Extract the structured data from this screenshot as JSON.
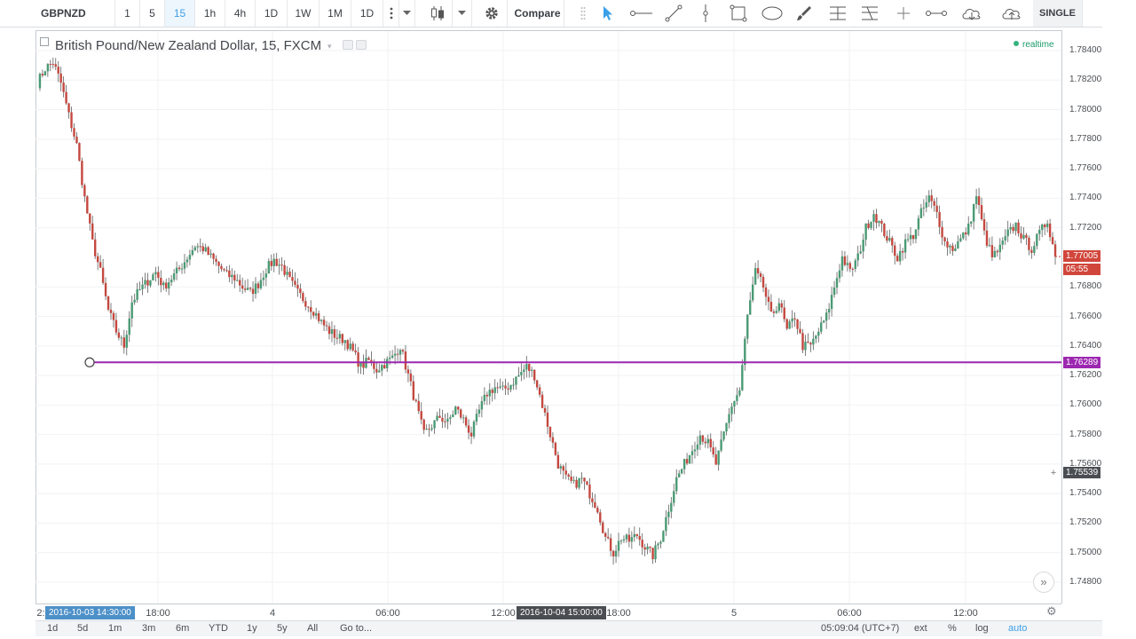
{
  "toolbar": {
    "symbol": "GBPNZD",
    "intervals": [
      "1",
      "5",
      "15",
      "1h",
      "4h",
      "1D",
      "1W",
      "1M",
      "1D"
    ],
    "active_interval": "15",
    "compare_label": "Compare",
    "layout_label": "SINGLE",
    "drawing_tools": [
      "cursor-icon",
      "horizontal-ray-icon",
      "trend-line-icon",
      "vertical-line-icon",
      "rectangle-icon",
      "ellipse-icon",
      "brush-icon",
      "fib-retracement-icon",
      "fib-extension-icon",
      "crosshair-icon",
      "measure-icon",
      "cloud-download-icon",
      "cloud-upload-icon"
    ]
  },
  "chart": {
    "title": "British Pound/New Zealand Dollar, 15, FXCM",
    "status": "realtime",
    "up_color": "#4a9a74",
    "down_color": "#c4483f",
    "drawn_line_color": "#9c27b0"
  },
  "price_scale": {
    "labels": [
      "1.78400",
      "1.78200",
      "1.78000",
      "1.77800",
      "1.77600",
      "1.77400",
      "1.77200",
      "1.76800",
      "1.76600",
      "1.76400",
      "1.76200",
      "1.76000",
      "1.75800",
      "1.75600",
      "1.75400",
      "1.75200",
      "1.75000",
      "1.74800"
    ],
    "last_price": "1.77005",
    "countdown": "05:55",
    "line_price": "1.76289",
    "cursor_price": "1.75539"
  },
  "time_scale": {
    "labels": [
      "18:00",
      "4",
      "06:00",
      "12:00",
      "18:00",
      "5",
      "06:00",
      "12:00"
    ],
    "left_edge_label": "2:",
    "cursor_tag_start": "2016-10-03 14:30:00",
    "cursor_tag_mid": "2016-10-04 15:00:00"
  },
  "bottom_bar": {
    "ranges": [
      "1d",
      "5d",
      "1m",
      "3m",
      "6m",
      "YTD",
      "1y",
      "5y",
      "All"
    ],
    "goto_label": "Go to...",
    "clock": "05:09:04 (UTC+7)",
    "options": [
      "ext",
      "%",
      "log",
      "auto"
    ],
    "active_option": "auto"
  },
  "chart_data": {
    "type": "candlestick",
    "title": "British Pound/New Zealand Dollar, 15, FXCM",
    "x_start": "2016-10-03 14:30",
    "x_end": "2016-10-05 14:30",
    "interval_minutes": 15,
    "ylim": [
      1.7475,
      1.785
    ],
    "close_path": [
      [
        0,
        1.7818
      ],
      [
        3,
        1.7828
      ],
      [
        6,
        1.7832
      ],
      [
        9,
        1.7818
      ],
      [
        12,
        1.7796
      ],
      [
        15,
        1.7776
      ],
      [
        18,
        1.774
      ],
      [
        21,
        1.771
      ],
      [
        24,
        1.769
      ],
      [
        27,
        1.7664
      ],
      [
        30,
        1.765
      ],
      [
        33,
        1.764
      ],
      [
        36,
        1.767
      ],
      [
        39,
        1.7678
      ],
      [
        42,
        1.7684
      ],
      [
        45,
        1.769
      ],
      [
        48,
        1.768
      ],
      [
        51,
        1.7686
      ],
      [
        54,
        1.7692
      ],
      [
        57,
        1.77
      ],
      [
        60,
        1.7708
      ],
      [
        63,
        1.7706
      ],
      [
        66,
        1.77
      ],
      [
        69,
        1.7694
      ],
      [
        72,
        1.7688
      ],
      [
        75,
        1.7686
      ],
      [
        78,
        1.768
      ],
      [
        81,
        1.7676
      ],
      [
        84,
        1.7682
      ],
      [
        87,
        1.7692
      ],
      [
        90,
        1.7698
      ],
      [
        93,
        1.7694
      ],
      [
        96,
        1.7684
      ],
      [
        99,
        1.7676
      ],
      [
        102,
        1.767
      ],
      [
        105,
        1.7664
      ],
      [
        108,
        1.7656
      ],
      [
        111,
        1.765
      ],
      [
        114,
        1.7646
      ],
      [
        117,
        1.7644
      ],
      [
        120,
        1.7636
      ],
      [
        123,
        1.7626
      ],
      [
        126,
        1.763
      ],
      [
        129,
        1.7624
      ],
      [
        132,
        1.7628
      ],
      [
        135,
        1.7632
      ],
      [
        138,
        1.764
      ],
      [
        141,
        1.762
      ],
      [
        144,
        1.76
      ],
      [
        147,
        1.758
      ],
      [
        150,
        1.7586
      ],
      [
        153,
        1.7592
      ],
      [
        156,
        1.7588
      ],
      [
        159,
        1.7598
      ],
      [
        162,
        1.759
      ],
      [
        165,
        1.758
      ],
      [
        168,
        1.7596
      ],
      [
        171,
        1.7608
      ],
      [
        174,
        1.7612
      ],
      [
        177,
        1.761
      ],
      [
        180,
        1.7614
      ],
      [
        183,
        1.762
      ],
      [
        186,
        1.7626
      ],
      [
        189,
        1.762
      ],
      [
        192,
        1.76
      ],
      [
        195,
        1.758
      ],
      [
        198,
        1.756
      ],
      [
        201,
        1.755
      ],
      [
        204,
        1.7546
      ],
      [
        207,
        1.755
      ],
      [
        210,
        1.754
      ],
      [
        213,
        1.753
      ],
      [
        216,
        1.751
      ],
      [
        219,
        1.75
      ],
      [
        222,
        1.751
      ],
      [
        225,
        1.7508
      ],
      [
        228,
        1.7512
      ],
      [
        231,
        1.7504
      ],
      [
        234,
        1.7498
      ],
      [
        237,
        1.751
      ],
      [
        240,
        1.753
      ],
      [
        243,
        1.755
      ],
      [
        246,
        1.756
      ],
      [
        249,
        1.757
      ],
      [
        252,
        1.758
      ],
      [
        255,
        1.7574
      ],
      [
        258,
        1.756
      ],
      [
        261,
        1.758
      ],
      [
        264,
        1.76
      ],
      [
        267,
        1.761
      ],
      [
        270,
        1.766
      ],
      [
        273,
        1.769
      ],
      [
        276,
        1.768
      ],
      [
        279,
        1.766
      ],
      [
        282,
        1.767
      ],
      [
        285,
        1.765
      ],
      [
        288,
        1.766
      ],
      [
        291,
        1.764
      ],
      [
        294,
        1.764
      ],
      [
        297,
        1.765
      ],
      [
        300,
        1.766
      ],
      [
        303,
        1.768
      ],
      [
        306,
        1.77
      ],
      [
        309,
        1.769
      ],
      [
        312,
        1.77
      ],
      [
        315,
        1.772
      ],
      [
        318,
        1.773
      ],
      [
        321,
        1.772
      ],
      [
        324,
        1.771
      ],
      [
        327,
        1.77
      ],
      [
        330,
        1.771
      ],
      [
        333,
        1.7715
      ],
      [
        336,
        1.773
      ],
      [
        339,
        1.774
      ],
      [
        342,
        1.773
      ],
      [
        345,
        1.771
      ],
      [
        348,
        1.7706
      ],
      [
        351,
        1.7712
      ],
      [
        354,
        1.772
      ],
      [
        357,
        1.7742
      ],
      [
        360,
        1.7716
      ],
      [
        363,
        1.77
      ],
      [
        366,
        1.7706
      ],
      [
        369,
        1.7716
      ],
      [
        372,
        1.7722
      ],
      [
        375,
        1.7712
      ],
      [
        378,
        1.7706
      ],
      [
        381,
        1.7716
      ],
      [
        384,
        1.7725
      ],
      [
        387,
        1.7701
      ]
    ],
    "horizontal_line": 1.76289,
    "last_price": 1.77005,
    "cursor_price": 1.75539
  }
}
